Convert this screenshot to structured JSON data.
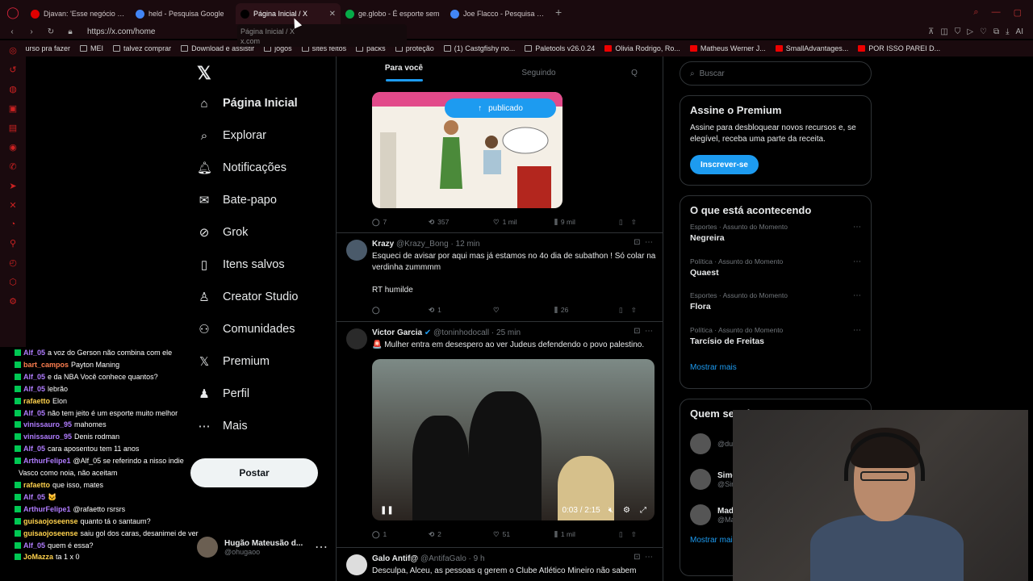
{
  "browser": {
    "tabs": [
      {
        "label": "Djavan: 'Esse negócio de c",
        "favicon": "youtube-icon",
        "color": "#e00000"
      },
      {
        "label": "held - Pesquisa Google",
        "favicon": "google-icon",
        "color": "#4285f4"
      },
      {
        "label": "Página Inicial / X",
        "favicon": "x-icon",
        "color": "#000000",
        "active": true
      },
      {
        "label": "ge.globo - É esporte sem",
        "favicon": "ge-icon",
        "color": "#06aa48"
      },
      {
        "label": "Joe Flacco - Pesquisa Goo",
        "favicon": "google-icon",
        "color": "#4285f4"
      }
    ],
    "url": "https://x.com/home",
    "tooltip_title": "Página Inicial / X",
    "tooltip_url": "x.com",
    "bookmarks": [
      {
        "label": "Curso pra fazer",
        "type": "folder"
      },
      {
        "label": "MEI",
        "type": "folder"
      },
      {
        "label": "talvez comprar",
        "type": "folder"
      },
      {
        "label": "Download e assistir",
        "type": "folder"
      },
      {
        "label": "jogos",
        "type": "folder"
      },
      {
        "label": "sites feitos",
        "type": "folder"
      },
      {
        "label": "packs",
        "type": "folder"
      },
      {
        "label": "proteção",
        "type": "folder"
      },
      {
        "label": "(1) Castgfishy no...",
        "type": "x"
      },
      {
        "label": "Paletools v26.0.24",
        "type": "page"
      },
      {
        "label": "Olivia Rodrigo, Ro...",
        "type": "youtube"
      },
      {
        "label": "Matheus Werner J...",
        "type": "youtube"
      },
      {
        "label": "SmallAdvantages...",
        "type": "youtube"
      },
      {
        "label": "POR ISSO PAREI D...",
        "type": "youtube"
      }
    ],
    "accent": "#d0243a"
  },
  "nav": {
    "items": [
      {
        "label": "Página Inicial",
        "icon": "home-icon",
        "glyph": "⌂",
        "active": true
      },
      {
        "label": "Explorar",
        "icon": "search-icon",
        "glyph": "⌕"
      },
      {
        "label": "Notificações",
        "icon": "bell-icon",
        "glyph": "🔔︎"
      },
      {
        "label": "Bate-papo",
        "icon": "mail-icon",
        "glyph": "✉"
      },
      {
        "label": "Grok",
        "icon": "grok-icon",
        "glyph": "⊘"
      },
      {
        "label": "Itens salvos",
        "icon": "bookmark-icon",
        "glyph": "▯"
      },
      {
        "label": "Creator Studio",
        "icon": "creator-icon",
        "glyph": "♙"
      },
      {
        "label": "Comunidades",
        "icon": "communities-icon",
        "glyph": "⚇"
      },
      {
        "label": "Premium",
        "icon": "x-premium-icon",
        "glyph": "𝕏"
      },
      {
        "label": "Perfil",
        "icon": "profile-icon",
        "glyph": "♟"
      },
      {
        "label": "Mais",
        "icon": "more-icon",
        "glyph": "⋯"
      }
    ],
    "post_label": "Postar",
    "account_name": "Hugão Mateusão d...",
    "account_handle": "@ohugaoo"
  },
  "timeline": {
    "tabs": [
      "Para você",
      "Seguindo",
      "Q"
    ],
    "pill_label": "publicado",
    "top_actions": {
      "replies": "7",
      "reposts": "357",
      "likes": "1 mil",
      "views": "9 mil"
    },
    "tweets": [
      {
        "name": "Krazy",
        "handle": "@Krazy_Bong · 12 min",
        "text": "Esqueci de avisar por aqui mas já estamos no 4o dia de subathon ! Só colar na verdinha zummmm",
        "text2": "RT humilde",
        "replies": "",
        "reposts": "1",
        "likes": "",
        "views": "26"
      },
      {
        "name": "Victor Garcia",
        "handle": "@toninhodocall · 25 min",
        "text": "🚨 Mulher entra em desespero ao ver Judeus defendendo o povo palestino.",
        "video_time": "0:03 / 2:15",
        "replies": "1",
        "reposts": "2",
        "likes": "51",
        "views": "1 mil"
      },
      {
        "name": "Galo Antif@",
        "handle": "@AntifaGalo · 9 h",
        "text": "Desculpa, Alceu, as pessoas q gerem o Clube Atlético Mineiro não sabem"
      }
    ]
  },
  "right": {
    "search_placeholder": "Buscar",
    "premium_title": "Assine o Premium",
    "premium_text": "Assine para desbloquear novos recursos e, se elegível, receba uma parte da receita.",
    "premium_button": "Inscrever-se",
    "trends_title": "O que está acontecendo",
    "trends": [
      {
        "category": "Esportes · Assunto do Momento",
        "title": "Negreira"
      },
      {
        "category": "Política · Assunto do Momento",
        "title": "Quaest"
      },
      {
        "category": "Esportes · Assunto do Momento",
        "title": "Flora"
      },
      {
        "category": "Política · Assunto do Momento",
        "title": "Tarcísio de Freitas"
      }
    ],
    "show_more": "Mostrar mais",
    "follow_title": "Quem seguir",
    "follow": [
      {
        "name": "",
        "handle": "@du"
      },
      {
        "name": "Simo",
        "handle": "@Sim"
      },
      {
        "name": "Mad",
        "handle": "@Ma"
      }
    ],
    "follow_show_more": "Mostrar mai"
  },
  "chat": [
    {
      "user": "Alf_05",
      "color": "#b07cff",
      "text": "a voz do Gerson não combina com ele"
    },
    {
      "user": "bart_campos",
      "color": "#ff7f50",
      "text": "Payton Maning"
    },
    {
      "user": "Alf_05",
      "color": "#b07cff",
      "text": "e da NBA Você conhece quantos?"
    },
    {
      "user": "Alf_05",
      "color": "#b07cff",
      "text": "lebrão"
    },
    {
      "user": "rafaetto",
      "color": "#ffd24d",
      "text": "Elon"
    },
    {
      "user": "Alf_05",
      "color": "#b07cff",
      "text": "não tem jeito é um esporte muito melhor"
    },
    {
      "user": "vinissauro_95",
      "color": "#b07cff",
      "text": "mahomes"
    },
    {
      "user": "vinissauro_95",
      "color": "#b07cff",
      "text": "Denis rodman"
    },
    {
      "user": "Alf_05",
      "color": "#b07cff",
      "text": "cara aposentou tem 11 anos"
    },
    {
      "user": "ArthurFelipe1",
      "color": "#b07cff",
      "text": "@Alf_05 se referindo a nisso indie"
    },
    {
      "user": "",
      "color": "#ffffff",
      "text": "Vasco como noia, não aceitam",
      "noicon": true
    },
    {
      "user": "rafaetto",
      "color": "#ffd24d",
      "text": "que isso, mates"
    },
    {
      "user": "Alf_05",
      "color": "#b07cff",
      "text": "🐱"
    },
    {
      "user": "ArthurFelipe1",
      "color": "#b07cff",
      "text": "@rafaetto rsrsrs"
    },
    {
      "user": "guisaojoseense",
      "color": "#ffd24d",
      "text": "quanto tá o santaum?"
    },
    {
      "user": "guisaojoseense",
      "color": "#ffd24d",
      "text": "saiu gol dos caras, desanimei de ver"
    },
    {
      "user": "Alf_05",
      "color": "#b07cff",
      "text": "quem é essa?"
    },
    {
      "user": "JoMazza",
      "color": "#ffd24d",
      "text": "ta 1 x 0"
    }
  ]
}
